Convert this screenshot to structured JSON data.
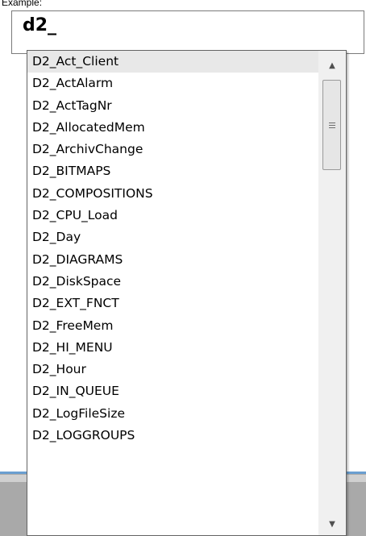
{
  "caption": "Example:",
  "input": {
    "value": "d2_"
  },
  "dropdown": {
    "items": [
      "D2_Act_Client",
      "D2_ActAlarm",
      "D2_ActTagNr",
      "D2_AllocatedMem",
      "D2_ArchivChange",
      "D2_BITMAPS",
      "D2_COMPOSITIONS",
      "D2_CPU_Load",
      "D2_Day",
      "D2_DIAGRAMS",
      "D2_DiskSpace",
      "D2_EXT_FNCT",
      "D2_FreeMem",
      "D2_HI_MENU",
      "D2_Hour",
      "D2_IN_QUEUE",
      "D2_LogFileSize",
      "D2_LOGGROUPS"
    ],
    "selected_index": 0
  },
  "scrollbar": {
    "up_icon": "arrow-up-icon",
    "down_icon": "arrow-down-icon",
    "up_glyph": "▲",
    "down_glyph": "▼"
  }
}
